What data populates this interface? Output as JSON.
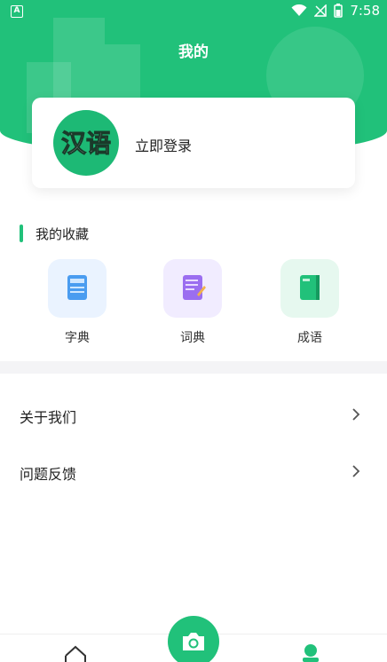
{
  "status_bar": {
    "left_icon": "A",
    "time": "7:58",
    "icons": [
      "wifi-icon",
      "no-signal-icon",
      "battery-icon"
    ]
  },
  "header": {
    "title": "我的",
    "color": "#21c17a"
  },
  "login_card": {
    "logo_text": "汉语",
    "logo_icon": "app-logo",
    "login_label": "立即登录"
  },
  "favorites": {
    "title": "我的收藏",
    "items": [
      {
        "label": "字典",
        "icon": "dictionary-book-icon",
        "tile_color": "#eaf3ff"
      },
      {
        "label": "词典",
        "icon": "word-dictionary-icon",
        "tile_color": "#f1ecff"
      },
      {
        "label": "成语",
        "icon": "idiom-book-icon",
        "tile_color": "#e6f8ef"
      }
    ]
  },
  "menu": {
    "items": [
      {
        "label": "关于我们",
        "icon": "chevron-right-icon"
      },
      {
        "label": "问题反馈",
        "icon": "chevron-right-icon"
      }
    ]
  },
  "bottom_nav": {
    "items": [
      {
        "icon": "home-icon"
      },
      {
        "icon": "camera-icon"
      },
      {
        "icon": "profile-icon"
      }
    ]
  }
}
